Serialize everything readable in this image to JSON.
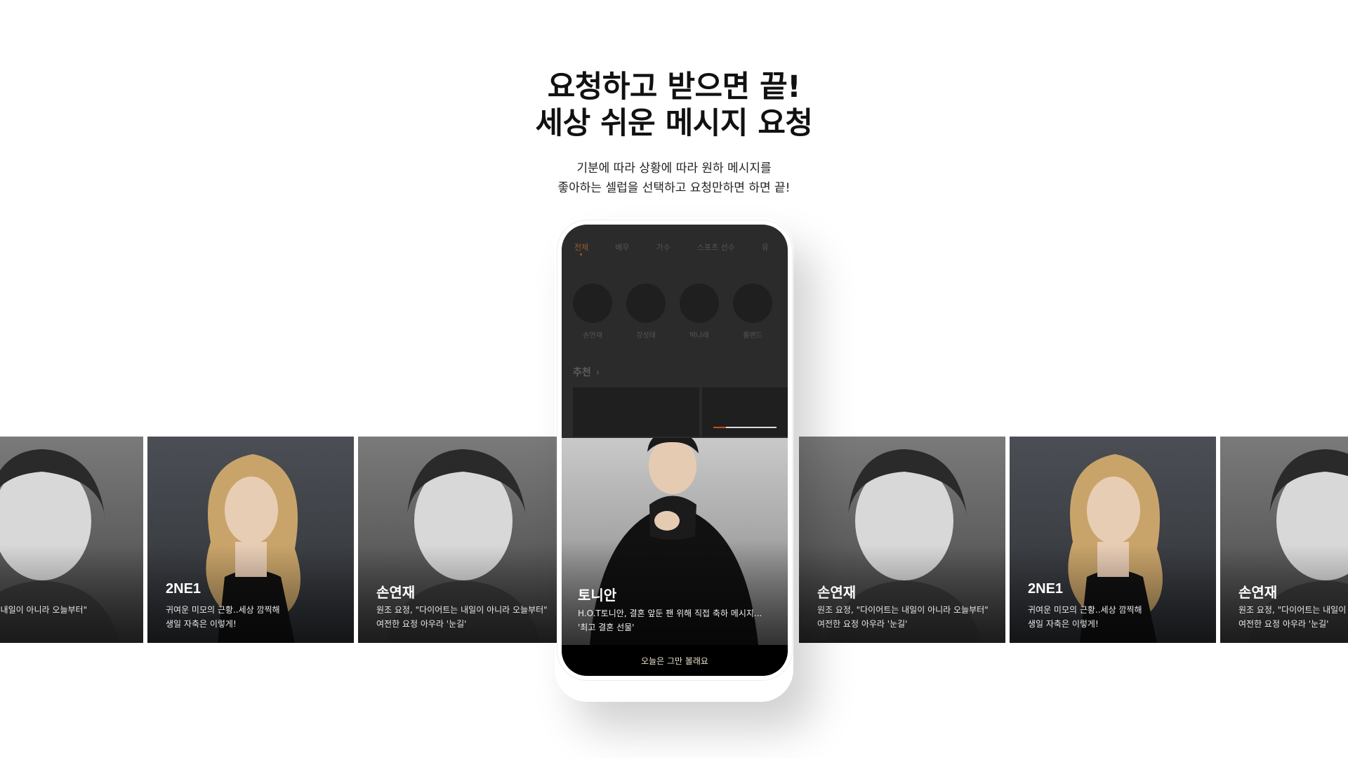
{
  "headline": {
    "line1": "요청하고 받으면 끝!",
    "line2": "세상 쉬운 메시지 요청",
    "sub1": "기분에 따라 상황에 따라 원하 메시지를",
    "sub2": "좋아하는 셀럽을 선택하고 요청만하면 하면 끝!"
  },
  "cards": [
    {
      "name": "",
      "desc": "\"다이어트는 내일이 아니라 오늘부터\"\n이라 '눈길'",
      "style": "bw"
    },
    {
      "name": "2NE1",
      "desc": "귀여운 미모의 근황..세상 깜찍해\n생일 자축은 이렇게!",
      "style": "color"
    },
    {
      "name": "손연재",
      "desc": "원조 요정, \"다이어트는 내일이 아니라 오늘부터\"\n여전한 요정 아우라 '눈길'",
      "style": "bw"
    }
  ],
  "cards_right": [
    {
      "name": "손연재",
      "desc": "원조 요정, \"다이어트는 내일이 아니라 오늘부터\"\n여전한 요정 아우라 '눈길'",
      "style": "bw"
    },
    {
      "name": "2NE1",
      "desc": "귀여운 미모의 근황..세상 깜찍해\n생일 자축은 이렇게!",
      "style": "color"
    },
    {
      "name": "손연재",
      "desc": "원조 요정, \"다이어트는 내일이 아니라 오늘부터\"\n여전한 요정 아우라 '눈길'",
      "style": "bw"
    }
  ],
  "phone": {
    "tabs": [
      "전체",
      "배우",
      "가수",
      "스포츠 선수",
      "유"
    ],
    "celebs": [
      "손연재",
      "강성태",
      "박나래",
      "롤랜드"
    ],
    "recommend_title": "추천",
    "progress": 0.2,
    "feature": {
      "name": "토니안",
      "desc": "H.O.T토니안, 결혼 앞둔 팬 위해 직접 축하 메시지...\n'최고 결혼 선물'"
    },
    "dismiss_label": "오늘은 그만 볼래요"
  },
  "colors": {
    "accent": "#e05a1e",
    "active_tab": "#9a5a2a"
  }
}
